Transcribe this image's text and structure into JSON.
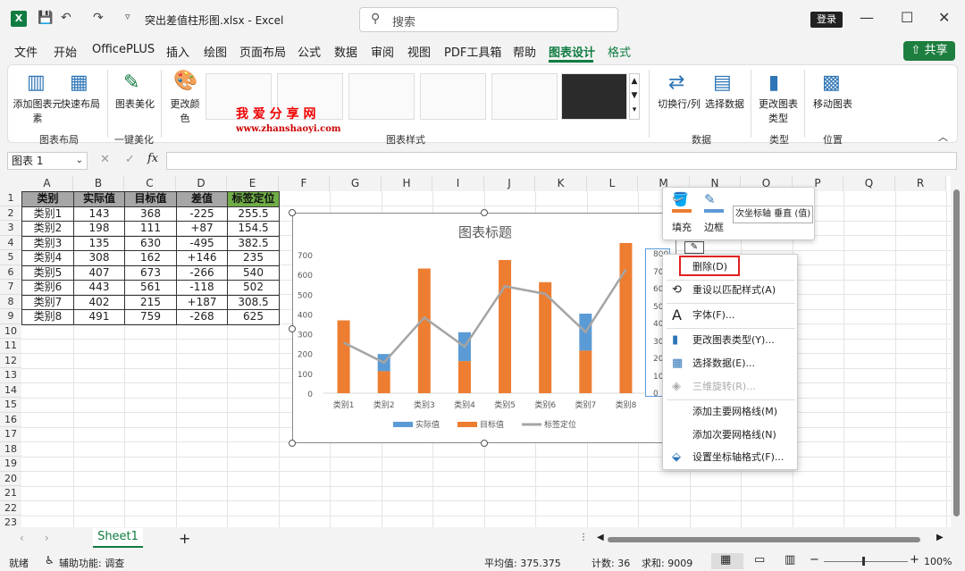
{
  "window": {
    "filename": "突出差值柱形图.xlsx",
    "app": "Excel",
    "search_placeholder": "搜索",
    "login": "登录",
    "share": "共享"
  },
  "tabs": [
    "文件",
    "开始",
    "OfficePLUS",
    "插入",
    "绘图",
    "页面布局",
    "公式",
    "数据",
    "审阅",
    "视图",
    "PDF工具箱",
    "帮助",
    "图表设计",
    "格式"
  ],
  "ribbon": {
    "add_element": "添加图表元素",
    "quick_layout": "快速布局",
    "beautify": "图表美化",
    "change_color": "更改颜色",
    "switch_rowcol": "切换行/列",
    "select_data": "选择数据",
    "change_type": "更改图表类型",
    "move_chart": "移动图表",
    "group_layout": "图表布局",
    "group_onekey": "一键美化",
    "group_styles": "图表样式",
    "group_data": "数据",
    "group_type": "类型",
    "group_location": "位置",
    "watermark": "我 爱 分 享 网",
    "watermark_url": "www.zhanshaoyi.com"
  },
  "formula": {
    "namebox": "图表 1",
    "fx": "fx"
  },
  "columns": [
    "A",
    "B",
    "C",
    "D",
    "E",
    "F",
    "G",
    "H",
    "I",
    "J",
    "K",
    "L",
    "M",
    "N",
    "O",
    "P",
    "Q",
    "R"
  ],
  "rows": [
    "1",
    "2",
    "3",
    "4",
    "5",
    "6",
    "7",
    "8",
    "9",
    "10",
    "11",
    "12",
    "13",
    "14",
    "15",
    "16",
    "17",
    "18",
    "19",
    "20",
    "21",
    "22",
    "23"
  ],
  "table": {
    "headers": [
      "类别",
      "实际值",
      "目标值",
      "差值",
      "标签定位"
    ],
    "rows": [
      [
        "类别1",
        "143",
        "368",
        "-225",
        "255.5"
      ],
      [
        "类别2",
        "198",
        "111",
        "+87",
        "154.5"
      ],
      [
        "类别3",
        "135",
        "630",
        "-495",
        "382.5"
      ],
      [
        "类别4",
        "308",
        "162",
        "+146",
        "235"
      ],
      [
        "类别5",
        "407",
        "673",
        "-266",
        "540"
      ],
      [
        "类别6",
        "443",
        "561",
        "-118",
        "502"
      ],
      [
        "类别7",
        "402",
        "215",
        "+187",
        "308.5"
      ],
      [
        "类别8",
        "491",
        "759",
        "-268",
        "625"
      ]
    ]
  },
  "chart_data": {
    "type": "bar",
    "title": "图表标题",
    "categories": [
      "类别1",
      "类别2",
      "类别3",
      "类别4",
      "类别5",
      "类别6",
      "类别7",
      "类别8"
    ],
    "series": [
      {
        "name": "实际值",
        "color": "#5b9bd5",
        "values": [
          143,
          198,
          135,
          308,
          407,
          443,
          402,
          491
        ]
      },
      {
        "name": "目标值",
        "color": "#ed7d31",
        "values": [
          368,
          111,
          630,
          162,
          673,
          561,
          215,
          759
        ]
      },
      {
        "name": "标签定位",
        "color": "#a5a5a5",
        "type": "line",
        "values": [
          255.5,
          154.5,
          382.5,
          235,
          540,
          502,
          308.5,
          625
        ]
      }
    ],
    "yticks": [
      "0",
      "100",
      "200",
      "300",
      "400",
      "500",
      "600",
      "700"
    ],
    "ylim": [
      0,
      700
    ],
    "secondary_axis_visible": [
      "800",
      "70",
      "60",
      "50",
      "40",
      "30",
      "20",
      "10",
      "0"
    ],
    "legend_position": "bottom"
  },
  "minibar": {
    "fill": "填充",
    "border": "边框",
    "dropdown": "次坐标轴 垂直 (值)"
  },
  "context_menu": [
    "删除(D)",
    "重设以匹配样式(A)",
    "字体(F)...",
    "更改图表类型(Y)...",
    "选择数据(E)...",
    "三维旋转(R)...",
    "添加主要网格线(M)",
    "添加次要网格线(N)",
    "设置坐标轴格式(F)..."
  ],
  "sheet_tab": "Sheet1",
  "status": {
    "ready": "就绪",
    "accessibility": "辅助功能: 调查",
    "average": "平均值: 375.375",
    "count": "计数: 36",
    "sum": "求和: 9009",
    "zoom": "100%"
  }
}
